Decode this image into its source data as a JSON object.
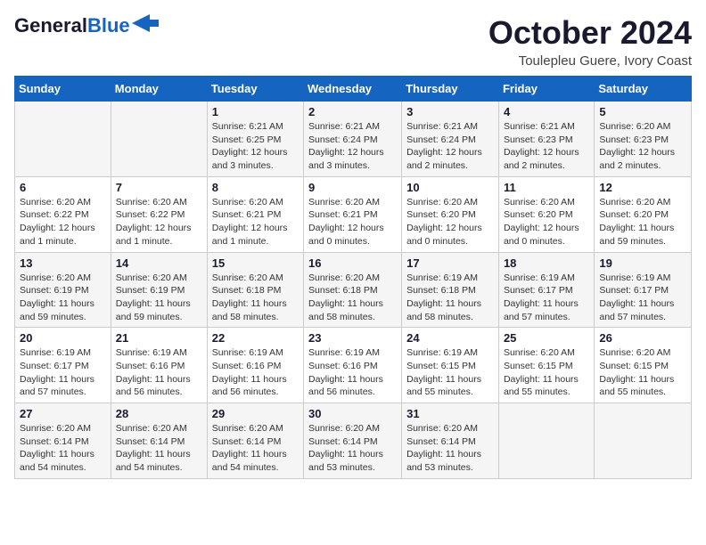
{
  "header": {
    "logo_general": "General",
    "logo_blue": "Blue",
    "month_title": "October 2024",
    "location": "Toulepleu Guere, Ivory Coast"
  },
  "days_of_week": [
    "Sunday",
    "Monday",
    "Tuesday",
    "Wednesday",
    "Thursday",
    "Friday",
    "Saturday"
  ],
  "weeks": [
    [
      {
        "day": "",
        "info": ""
      },
      {
        "day": "",
        "info": ""
      },
      {
        "day": "1",
        "info": "Sunrise: 6:21 AM\nSunset: 6:25 PM\nDaylight: 12 hours and 3 minutes."
      },
      {
        "day": "2",
        "info": "Sunrise: 6:21 AM\nSunset: 6:24 PM\nDaylight: 12 hours and 3 minutes."
      },
      {
        "day": "3",
        "info": "Sunrise: 6:21 AM\nSunset: 6:24 PM\nDaylight: 12 hours and 2 minutes."
      },
      {
        "day": "4",
        "info": "Sunrise: 6:21 AM\nSunset: 6:23 PM\nDaylight: 12 hours and 2 minutes."
      },
      {
        "day": "5",
        "info": "Sunrise: 6:20 AM\nSunset: 6:23 PM\nDaylight: 12 hours and 2 minutes."
      }
    ],
    [
      {
        "day": "6",
        "info": "Sunrise: 6:20 AM\nSunset: 6:22 PM\nDaylight: 12 hours and 1 minute."
      },
      {
        "day": "7",
        "info": "Sunrise: 6:20 AM\nSunset: 6:22 PM\nDaylight: 12 hours and 1 minute."
      },
      {
        "day": "8",
        "info": "Sunrise: 6:20 AM\nSunset: 6:21 PM\nDaylight: 12 hours and 1 minute."
      },
      {
        "day": "9",
        "info": "Sunrise: 6:20 AM\nSunset: 6:21 PM\nDaylight: 12 hours and 0 minutes."
      },
      {
        "day": "10",
        "info": "Sunrise: 6:20 AM\nSunset: 6:20 PM\nDaylight: 12 hours and 0 minutes."
      },
      {
        "day": "11",
        "info": "Sunrise: 6:20 AM\nSunset: 6:20 PM\nDaylight: 12 hours and 0 minutes."
      },
      {
        "day": "12",
        "info": "Sunrise: 6:20 AM\nSunset: 6:20 PM\nDaylight: 11 hours and 59 minutes."
      }
    ],
    [
      {
        "day": "13",
        "info": "Sunrise: 6:20 AM\nSunset: 6:19 PM\nDaylight: 11 hours and 59 minutes."
      },
      {
        "day": "14",
        "info": "Sunrise: 6:20 AM\nSunset: 6:19 PM\nDaylight: 11 hours and 59 minutes."
      },
      {
        "day": "15",
        "info": "Sunrise: 6:20 AM\nSunset: 6:18 PM\nDaylight: 11 hours and 58 minutes."
      },
      {
        "day": "16",
        "info": "Sunrise: 6:20 AM\nSunset: 6:18 PM\nDaylight: 11 hours and 58 minutes."
      },
      {
        "day": "17",
        "info": "Sunrise: 6:19 AM\nSunset: 6:18 PM\nDaylight: 11 hours and 58 minutes."
      },
      {
        "day": "18",
        "info": "Sunrise: 6:19 AM\nSunset: 6:17 PM\nDaylight: 11 hours and 57 minutes."
      },
      {
        "day": "19",
        "info": "Sunrise: 6:19 AM\nSunset: 6:17 PM\nDaylight: 11 hours and 57 minutes."
      }
    ],
    [
      {
        "day": "20",
        "info": "Sunrise: 6:19 AM\nSunset: 6:17 PM\nDaylight: 11 hours and 57 minutes."
      },
      {
        "day": "21",
        "info": "Sunrise: 6:19 AM\nSunset: 6:16 PM\nDaylight: 11 hours and 56 minutes."
      },
      {
        "day": "22",
        "info": "Sunrise: 6:19 AM\nSunset: 6:16 PM\nDaylight: 11 hours and 56 minutes."
      },
      {
        "day": "23",
        "info": "Sunrise: 6:19 AM\nSunset: 6:16 PM\nDaylight: 11 hours and 56 minutes."
      },
      {
        "day": "24",
        "info": "Sunrise: 6:19 AM\nSunset: 6:15 PM\nDaylight: 11 hours and 55 minutes."
      },
      {
        "day": "25",
        "info": "Sunrise: 6:20 AM\nSunset: 6:15 PM\nDaylight: 11 hours and 55 minutes."
      },
      {
        "day": "26",
        "info": "Sunrise: 6:20 AM\nSunset: 6:15 PM\nDaylight: 11 hours and 55 minutes."
      }
    ],
    [
      {
        "day": "27",
        "info": "Sunrise: 6:20 AM\nSunset: 6:14 PM\nDaylight: 11 hours and 54 minutes."
      },
      {
        "day": "28",
        "info": "Sunrise: 6:20 AM\nSunset: 6:14 PM\nDaylight: 11 hours and 54 minutes."
      },
      {
        "day": "29",
        "info": "Sunrise: 6:20 AM\nSunset: 6:14 PM\nDaylight: 11 hours and 54 minutes."
      },
      {
        "day": "30",
        "info": "Sunrise: 6:20 AM\nSunset: 6:14 PM\nDaylight: 11 hours and 53 minutes."
      },
      {
        "day": "31",
        "info": "Sunrise: 6:20 AM\nSunset: 6:14 PM\nDaylight: 11 hours and 53 minutes."
      },
      {
        "day": "",
        "info": ""
      },
      {
        "day": "",
        "info": ""
      }
    ]
  ]
}
